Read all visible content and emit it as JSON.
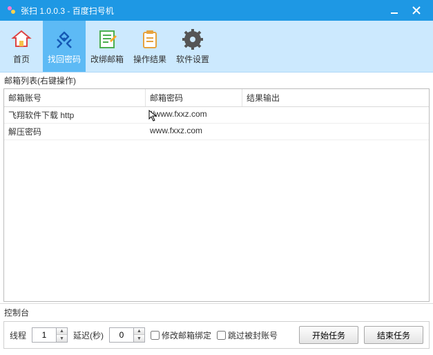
{
  "window": {
    "title": "张扫 1.0.0.3  -  百度扫号机"
  },
  "toolbar": {
    "home": "首页",
    "find_pwd": "找回密码",
    "change_mail": "改绑邮箱",
    "op_result": "操作结果",
    "sw_setting": "软件设置"
  },
  "list": {
    "label": "邮箱列表(右键操作)",
    "columns": {
      "c1": "邮箱账号",
      "c2": "邮箱密码",
      "c3": "结果输出"
    },
    "rows": [
      {
        "acct": "飞翔软件下载 http",
        "pwd": "//www.fxxz.com",
        "res": ""
      },
      {
        "acct": "解压密码",
        "pwd": "www.fxxz.com",
        "res": ""
      }
    ]
  },
  "control": {
    "label": "控制台",
    "threads_label": "线程",
    "threads": "1",
    "delay_label": "延迟(秒)",
    "delay": "0",
    "cb_modify_mail": "修改邮箱绑定",
    "cb_skip_blocked": "跳过被封账号",
    "start": "开始任务",
    "stop": "结束任务"
  },
  "colors": {
    "primary": "#1e98e4",
    "toolbar_bg": "#cce9fe",
    "active": "#5dbaf5"
  }
}
